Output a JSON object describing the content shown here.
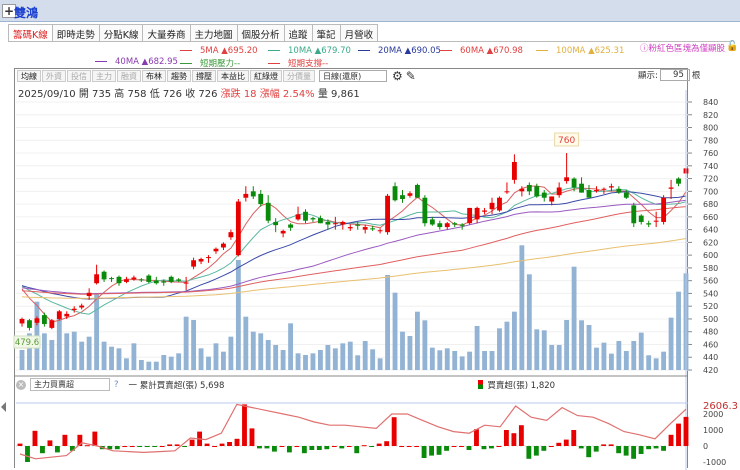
{
  "header": {
    "add_label": "+",
    "stock_name": "雙鴻"
  },
  "tabs": [
    "籌碼K線",
    "即時走勢",
    "分點K線",
    "大量券商",
    "主力地圖",
    "個股分析",
    "追蹤",
    "筆記",
    "月營收"
  ],
  "ma_legend": [
    {
      "label": "5MA ▲695.20",
      "color": "#e04040"
    },
    {
      "label": "10MA ▲679.70",
      "color": "#3aaa8a"
    },
    {
      "label": "20MA ▲690.05",
      "color": "#2a3a9a"
    },
    {
      "label": "60MA ▲670.98",
      "color": "#e04040"
    },
    {
      "label": "100MA ▲625.31",
      "color": "#e0b040"
    },
    {
      "label": "40MA ▲682.95",
      "color": "#8a3ab0"
    },
    {
      "label": "短期壓力--",
      "color": "#3a9a3a"
    },
    {
      "label": "短期支撐--",
      "color": "#e04040"
    }
  ],
  "notice": "ⓘ粉紅色區塊為僅顯股",
  "toolbar": {
    "buttons": [
      {
        "label": "均線",
        "enabled": true
      },
      {
        "label": "外資",
        "enabled": false
      },
      {
        "label": "投信",
        "enabled": false
      },
      {
        "label": "主力",
        "enabled": false
      },
      {
        "label": "融資",
        "enabled": false
      },
      {
        "label": "布林",
        "enabled": true
      },
      {
        "label": "趨勢",
        "enabled": true
      },
      {
        "label": "撐壓",
        "enabled": true
      },
      {
        "label": "本益比",
        "enabled": true
      },
      {
        "label": "紅綠燈",
        "enabled": true
      },
      {
        "label": "分價量",
        "enabled": false
      }
    ],
    "period": "日線(還原)",
    "show_label": "顯示:",
    "show_count": "95",
    "show_unit": "根"
  },
  "quote": {
    "date": "2025/09/10",
    "open": "開 735",
    "high": "高 758",
    "low": "低 726",
    "close": "收 726",
    "change": "漲跌 18",
    "pct": "漲幅 2.54%",
    "volume": "量 9,861"
  },
  "indicator": {
    "selected": "主力買賣超",
    "help": "?",
    "cum_label": "一 累計買賣超(張) 5,698",
    "bar_label": "買賣超(張) 1,820",
    "current": "2606.3",
    "axis": [
      "2000",
      "1000",
      "0",
      "-1000"
    ]
  },
  "chart_data": {
    "type": "candlestick",
    "price_axis": [
      "840",
      "820",
      "800",
      "780",
      "760",
      "740",
      "720",
      "700",
      "680",
      "660",
      "640",
      "620",
      "600",
      "580",
      "560",
      "540",
      "520",
      "500",
      "480",
      "460",
      "440",
      "420"
    ],
    "ylim": [
      420,
      840
    ],
    "high_marker": "760",
    "low_marker": "479.6",
    "candles": [
      [
        493,
        502,
        488,
        500
      ],
      [
        498,
        500,
        482,
        486
      ],
      [
        494,
        504,
        490,
        501
      ],
      [
        506,
        510,
        488,
        492
      ],
      [
        486,
        500,
        484,
        498
      ],
      [
        500,
        514,
        498,
        512
      ],
      [
        504,
        512,
        500,
        508
      ],
      [
        514,
        520,
        510,
        516
      ],
      [
        518,
        524,
        515,
        521
      ],
      [
        536,
        548,
        530,
        541
      ],
      [
        556,
        585,
        554,
        570
      ],
      [
        574,
        576,
        558,
        562
      ],
      [
        564,
        566,
        558,
        563
      ],
      [
        566,
        568,
        552,
        556
      ],
      [
        558,
        566,
        556,
        562
      ],
      [
        562,
        568,
        560,
        565
      ],
      [
        562,
        564,
        558,
        561
      ],
      [
        568,
        570,
        556,
        558
      ],
      [
        560,
        566,
        554,
        556
      ],
      [
        559,
        562,
        552,
        557
      ],
      [
        566,
        568,
        556,
        558
      ],
      [
        562,
        564,
        558,
        560
      ],
      [
        556,
        566,
        545,
        557
      ],
      [
        582,
        596,
        578,
        592
      ],
      [
        590,
        596,
        586,
        594
      ],
      [
        596,
        600,
        588,
        597
      ],
      [
        606,
        612,
        602,
        610
      ],
      [
        612,
        620,
        608,
        618
      ],
      [
        628,
        640,
        624,
        636
      ],
      [
        600,
        688,
        598,
        684
      ],
      [
        690,
        708,
        684,
        696
      ],
      [
        700,
        708,
        688,
        692
      ],
      [
        696,
        702,
        676,
        680
      ],
      [
        682,
        694,
        650,
        654
      ],
      [
        652,
        658,
        636,
        647
      ],
      [
        634,
        640,
        628,
        638
      ],
      [
        648,
        650,
        638,
        643
      ],
      [
        656,
        676,
        654,
        664
      ],
      [
        668,
        672,
        650,
        654
      ],
      [
        658,
        660,
        652,
        656
      ],
      [
        658,
        662,
        650,
        650
      ],
      [
        652,
        656,
        640,
        648
      ],
      [
        650,
        660,
        640,
        650
      ],
      [
        648,
        654,
        640,
        652
      ],
      [
        642,
        648,
        638,
        644
      ],
      [
        648,
        652,
        640,
        646
      ],
      [
        640,
        648,
        634,
        644
      ],
      [
        642,
        646,
        638,
        641
      ],
      [
        638,
        642,
        634,
        639
      ],
      [
        636,
        696,
        632,
        693
      ],
      [
        708,
        714,
        684,
        686
      ],
      [
        694,
        702,
        682,
        688
      ],
      [
        693,
        700,
        690,
        697
      ],
      [
        710,
        712,
        690,
        690
      ],
      [
        690,
        694,
        645,
        650
      ],
      [
        656,
        660,
        646,
        648
      ],
      [
        650,
        654,
        640,
        644
      ],
      [
        644,
        652,
        640,
        650
      ],
      [
        650,
        652,
        644,
        648
      ],
      [
        648,
        650,
        640,
        646
      ],
      [
        650,
        674,
        648,
        674
      ],
      [
        656,
        676,
        650,
        674
      ],
      [
        668,
        674,
        664,
        670
      ],
      [
        672,
        690,
        664,
        682
      ],
      [
        670,
        692,
        668,
        690
      ],
      [
        700,
        714,
        696,
        700
      ],
      [
        718,
        758,
        712,
        746
      ],
      [
        700,
        708,
        692,
        704
      ],
      [
        710,
        714,
        694,
        700
      ],
      [
        708,
        712,
        690,
        692
      ],
      [
        698,
        702,
        684,
        690
      ],
      [
        684,
        692,
        678,
        692
      ],
      [
        694,
        714,
        690,
        706
      ],
      [
        716,
        760,
        712,
        722
      ],
      [
        720,
        722,
        700,
        706
      ],
      [
        712,
        722,
        698,
        698
      ],
      [
        702,
        710,
        690,
        690
      ],
      [
        702,
        708,
        698,
        702
      ],
      [
        704,
        706,
        696,
        704
      ],
      [
        706,
        712,
        700,
        708
      ],
      [
        704,
        708,
        696,
        698
      ],
      [
        698,
        702,
        688,
        690
      ],
      [
        678,
        682,
        644,
        650
      ],
      [
        662,
        664,
        648,
        652
      ],
      [
        650,
        654,
        644,
        648
      ],
      [
        654,
        668,
        644,
        654
      ],
      [
        652,
        694,
        648,
        690
      ],
      [
        704,
        718,
        688,
        706
      ],
      [
        720,
        722,
        708,
        712
      ],
      [
        728,
        758,
        724,
        736
      ]
    ],
    "volumes": [
      2040,
      3740,
      6970,
      3740,
      3060,
      5270,
      3740,
      3910,
      2890,
      3400,
      7820,
      2890,
      2380,
      2210,
      1190,
      2720,
      1020,
      850,
      850,
      1530,
      1360,
      1700,
      5440,
      5100,
      2210,
      1360,
      2720,
      1870,
      3400,
      11220,
      5440,
      3910,
      3740,
      3060,
      2550,
      2040,
      4760,
      1700,
      1530,
      1700,
      2040,
      2550,
      2210,
      2720,
      2890,
      1500,
      2960,
      2110,
      1190,
      9690,
      7890,
      3910,
      3470,
      5950,
      5070,
      2280,
      2010,
      2210,
      1940,
      1390,
      1870,
      4490,
      1940,
      1940,
      4250,
      4930,
      5950,
      12720,
      9760,
      4150,
      4050,
      2550,
      2550,
      5100,
      10540,
      5070,
      4590,
      2280,
      2790,
      1670,
      2960,
      1940,
      2960,
      3810,
      1500,
      1190,
      1870,
      5340,
      7990,
      9861
    ],
    "net_buy_sell": [
      150,
      -1000,
      950,
      -450,
      350,
      -400,
      700,
      -300,
      700,
      50,
      900,
      -200,
      -200,
      -200,
      0,
      0,
      -50,
      -50,
      -50,
      0,
      100,
      100,
      -50,
      400,
      900,
      150,
      0,
      150,
      250,
      450,
      2600,
      1100,
      -150,
      -150,
      -350,
      0,
      -400,
      0,
      -450,
      -250,
      -250,
      -200,
      0,
      -150,
      0,
      -450,
      50,
      -50,
      150,
      300,
      1800,
      0,
      0,
      0,
      -750,
      -600,
      -550,
      -300,
      0,
      0,
      -250,
      1050,
      -200,
      -150,
      0,
      1000,
      800,
      1300,
      -800,
      -600,
      -300,
      0,
      200,
      400,
      1000,
      -150,
      -700,
      -350,
      100,
      100,
      -450,
      -600,
      -800,
      -500,
      -200,
      -150,
      -300,
      700,
      1400,
      1820
    ],
    "cumulative_line": [
      -500,
      -800,
      -700,
      -600,
      200,
      0,
      -300,
      -350,
      -400,
      -350,
      -300,
      500,
      400,
      800,
      2600,
      2400,
      2200,
      2000,
      1800,
      1500,
      1300,
      1300,
      1200,
      1100,
      2000,
      2000,
      1600,
      1200,
      900,
      800,
      1300,
      1200,
      2500,
      1800,
      1600,
      2400,
      1900,
      1800,
      1400,
      900,
      700,
      450,
      1400,
      2300
    ]
  }
}
